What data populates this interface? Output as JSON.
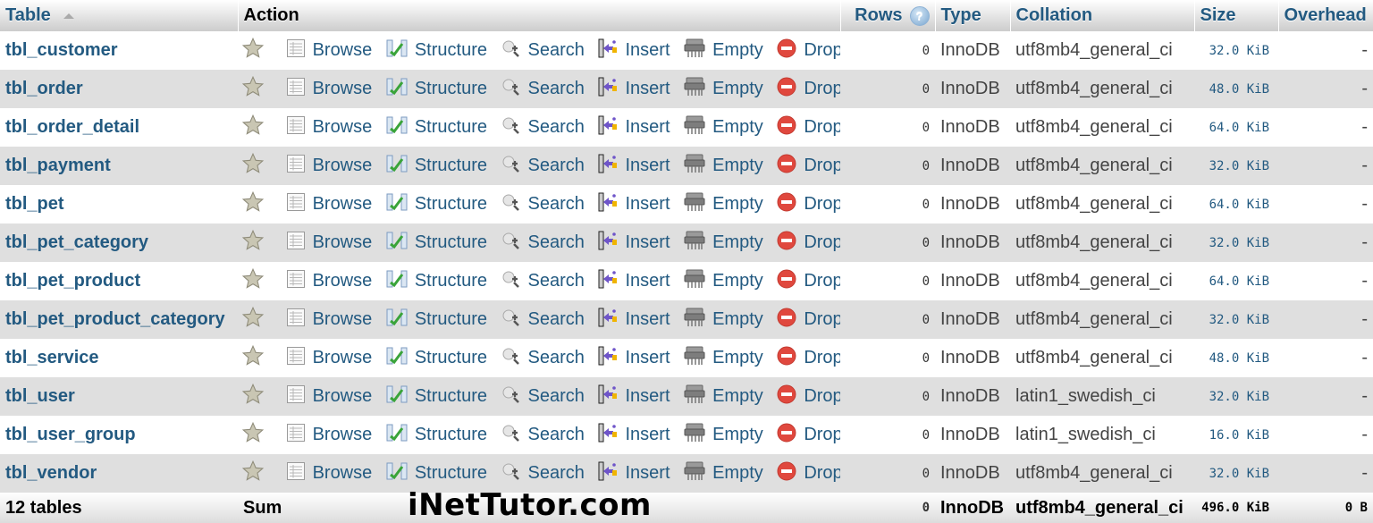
{
  "header": {
    "table": "Table",
    "action": "Action",
    "rows": "Rows",
    "type": "Type",
    "collation": "Collation",
    "size": "Size",
    "overhead": "Overhead"
  },
  "actions": {
    "browse": "Browse",
    "structure": "Structure",
    "search": "Search",
    "insert": "Insert",
    "empty": "Empty",
    "drop": "Drop"
  },
  "tables": [
    {
      "name": "tbl_customer",
      "rows": "0",
      "type": "InnoDB",
      "collation": "utf8mb4_general_ci",
      "size": "32.0 KiB",
      "overhead": "-"
    },
    {
      "name": "tbl_order",
      "rows": "0",
      "type": "InnoDB",
      "collation": "utf8mb4_general_ci",
      "size": "48.0 KiB",
      "overhead": "-"
    },
    {
      "name": "tbl_order_detail",
      "rows": "0",
      "type": "InnoDB",
      "collation": "utf8mb4_general_ci",
      "size": "64.0 KiB",
      "overhead": "-"
    },
    {
      "name": "tbl_payment",
      "rows": "0",
      "type": "InnoDB",
      "collation": "utf8mb4_general_ci",
      "size": "32.0 KiB",
      "overhead": "-"
    },
    {
      "name": "tbl_pet",
      "rows": "0",
      "type": "InnoDB",
      "collation": "utf8mb4_general_ci",
      "size": "64.0 KiB",
      "overhead": "-"
    },
    {
      "name": "tbl_pet_category",
      "rows": "0",
      "type": "InnoDB",
      "collation": "utf8mb4_general_ci",
      "size": "32.0 KiB",
      "overhead": "-"
    },
    {
      "name": "tbl_pet_product",
      "rows": "0",
      "type": "InnoDB",
      "collation": "utf8mb4_general_ci",
      "size": "64.0 KiB",
      "overhead": "-"
    },
    {
      "name": "tbl_pet_product_category",
      "rows": "0",
      "type": "InnoDB",
      "collation": "utf8mb4_general_ci",
      "size": "32.0 KiB",
      "overhead": "-"
    },
    {
      "name": "tbl_service",
      "rows": "0",
      "type": "InnoDB",
      "collation": "utf8mb4_general_ci",
      "size": "48.0 KiB",
      "overhead": "-"
    },
    {
      "name": "tbl_user",
      "rows": "0",
      "type": "InnoDB",
      "collation": "latin1_swedish_ci",
      "size": "32.0 KiB",
      "overhead": "-"
    },
    {
      "name": "tbl_user_group",
      "rows": "0",
      "type": "InnoDB",
      "collation": "latin1_swedish_ci",
      "size": "16.0 KiB",
      "overhead": "-"
    },
    {
      "name": "tbl_vendor",
      "rows": "0",
      "type": "InnoDB",
      "collation": "utf8mb4_general_ci",
      "size": "32.0 KiB",
      "overhead": "-"
    }
  ],
  "footer": {
    "count": "12 tables",
    "sum": "Sum",
    "watermark": "iNetTutor.com",
    "rows": "0",
    "type": "InnoDB",
    "collation": "utf8mb4_general_ci",
    "size": "496.0 KiB",
    "overhead": "0 B"
  },
  "colors": {
    "link": "#235a81",
    "row_alt": "#dfdfdf",
    "drop_red": "#e0483e"
  }
}
